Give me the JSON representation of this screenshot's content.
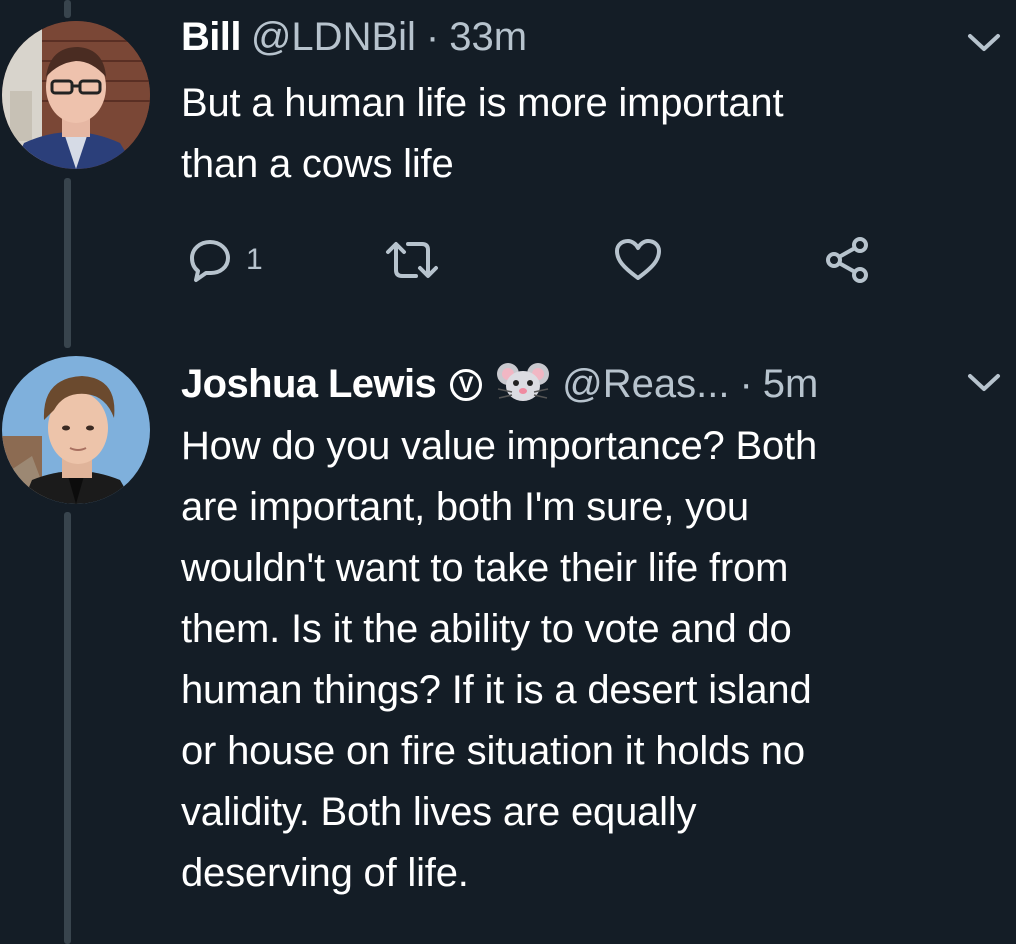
{
  "tweet1": {
    "name": "Bill",
    "handle": "@LDNBil",
    "separator": "·",
    "time": "33m",
    "text_lines": [
      "But a human life is more important",
      "than a cows life"
    ],
    "reply_count": "1",
    "icons": [
      "reply-icon",
      "retweet-icon",
      "like-icon",
      "share-icon",
      "chevron-down-icon"
    ]
  },
  "tweet2": {
    "name": "Joshua Lewis",
    "badge": "V",
    "handle": "@Reas...",
    "separator": "·",
    "time": "5m",
    "text_lines": [
      "How do you value importance? Both",
      "are important, both I'm sure, you",
      "wouldn't want to take their life from",
      "them. Is it the ability to vote and do",
      "human things? If it is a desert island",
      "or house on fire situation it holds no",
      "validity. Both lives are equally",
      "deserving of life."
    ],
    "icons": [
      "mouse-emoji-icon",
      "chevron-down-icon"
    ]
  },
  "colors": {
    "background": "#141d26",
    "secondary_text": "#b7c3cd",
    "thread_line": "#38444d"
  }
}
